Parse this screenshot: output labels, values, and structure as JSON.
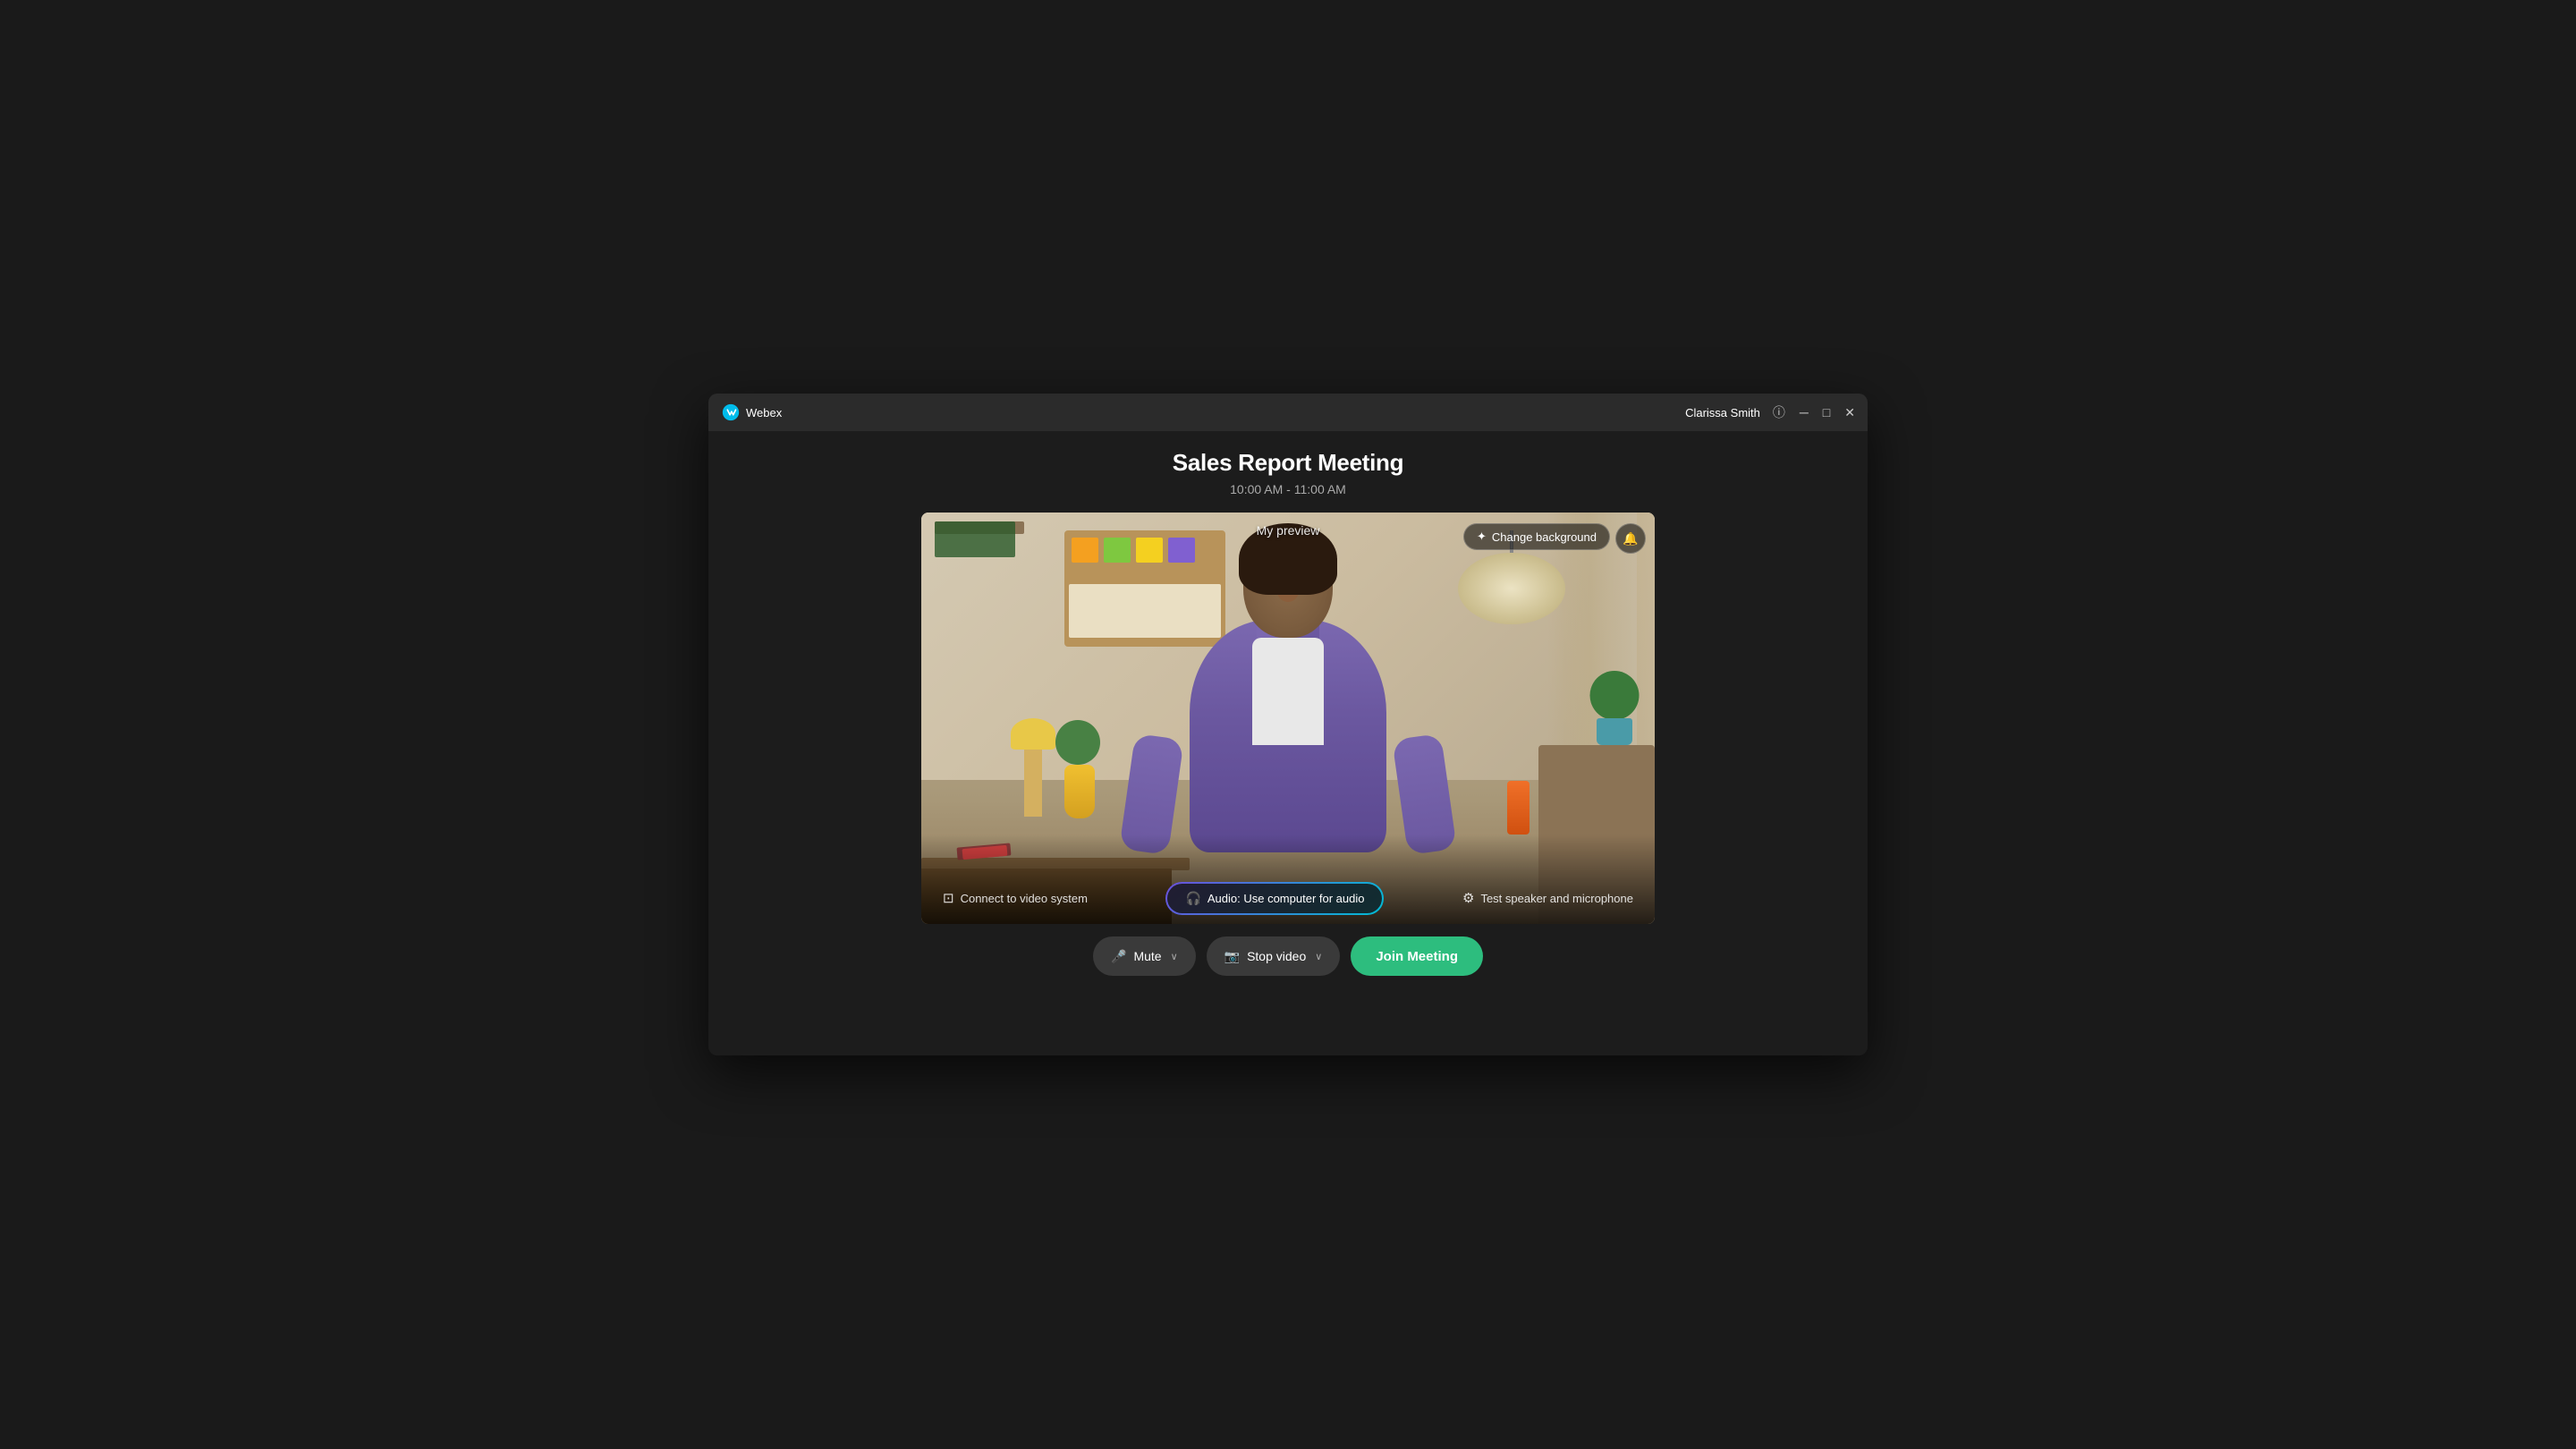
{
  "app": {
    "name": "Webex"
  },
  "titlebar": {
    "user": "Clarissa Smith",
    "info_tooltip": "Info",
    "minimize_label": "Minimize",
    "maximize_label": "Maximize",
    "close_label": "Close"
  },
  "meeting": {
    "title": "Sales Report Meeting",
    "time": "10:00 AM - 11:00 AM"
  },
  "video_preview": {
    "label": "My preview",
    "change_bg_label": "Change background",
    "connect_video_label": "Connect to video system",
    "audio_label": "Audio: Use computer for audio",
    "test_audio_label": "Test speaker and microphone"
  },
  "controls": {
    "mute_label": "Mute",
    "stop_video_label": "Stop video",
    "join_label": "Join Meeting"
  },
  "icons": {
    "wand": "✦",
    "speaker": "◄",
    "video_sys": "▣",
    "headphone": "◎",
    "gear": "⚙",
    "mic": "♪",
    "camera": "⬛",
    "chevron": "∨",
    "info": "ⓘ",
    "minimize": "─",
    "maximize": "□",
    "close": "✕"
  },
  "colors": {
    "accent_green": "#2DBD7E",
    "accent_purple": "#6B4FDB",
    "accent_cyan": "#00BCD4",
    "bg_dark": "#1c1c1c",
    "bg_medium": "#2b2b2b",
    "bg_btn": "#3a3a3a"
  }
}
